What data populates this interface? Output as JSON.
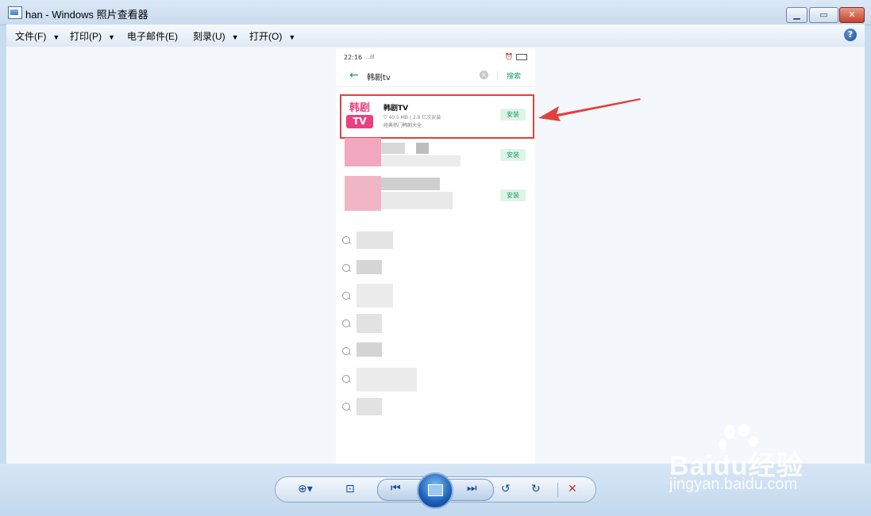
{
  "window": {
    "title": "han - Windows 照片查看器",
    "controls": [
      "minimize-icon",
      "maximize-icon",
      "close-icon"
    ]
  },
  "menu": {
    "items": [
      {
        "label": "文件(F)"
      },
      {
        "label": "打印(P)"
      },
      {
        "label": "电子邮件(E)"
      },
      {
        "label": "刻录(U)"
      },
      {
        "label": "打开(O)"
      }
    ],
    "help_icon": "help-icon"
  },
  "phone": {
    "status": {
      "time": "22:16",
      "signal": "..ıll"
    },
    "search": {
      "query": "韩剧tv",
      "button": "搜索"
    },
    "result": {
      "logo_top": "韩剧",
      "logo_bottom": "TV",
      "name": "韩剧TV",
      "size": "40.5 MB",
      "installs": "2.8 亿次安装",
      "description": "经典热门韩剧大全",
      "install_label": "安装"
    },
    "other_install_labels": [
      "安装",
      "安装"
    ]
  },
  "toolbar": {
    "icons": [
      "zoom-icon",
      "actual-size-icon",
      "previous-icon",
      "slideshow-icon",
      "next-icon",
      "rotate-left-icon",
      "rotate-right-icon",
      "delete-icon"
    ]
  },
  "watermark": {
    "brand": "Baidu经验",
    "url": "jingyan.baidu.com"
  },
  "colors": {
    "highlight": "#e2403d",
    "accent_green": "#1a9b5d",
    "logo_pink": "#ea3f82"
  }
}
